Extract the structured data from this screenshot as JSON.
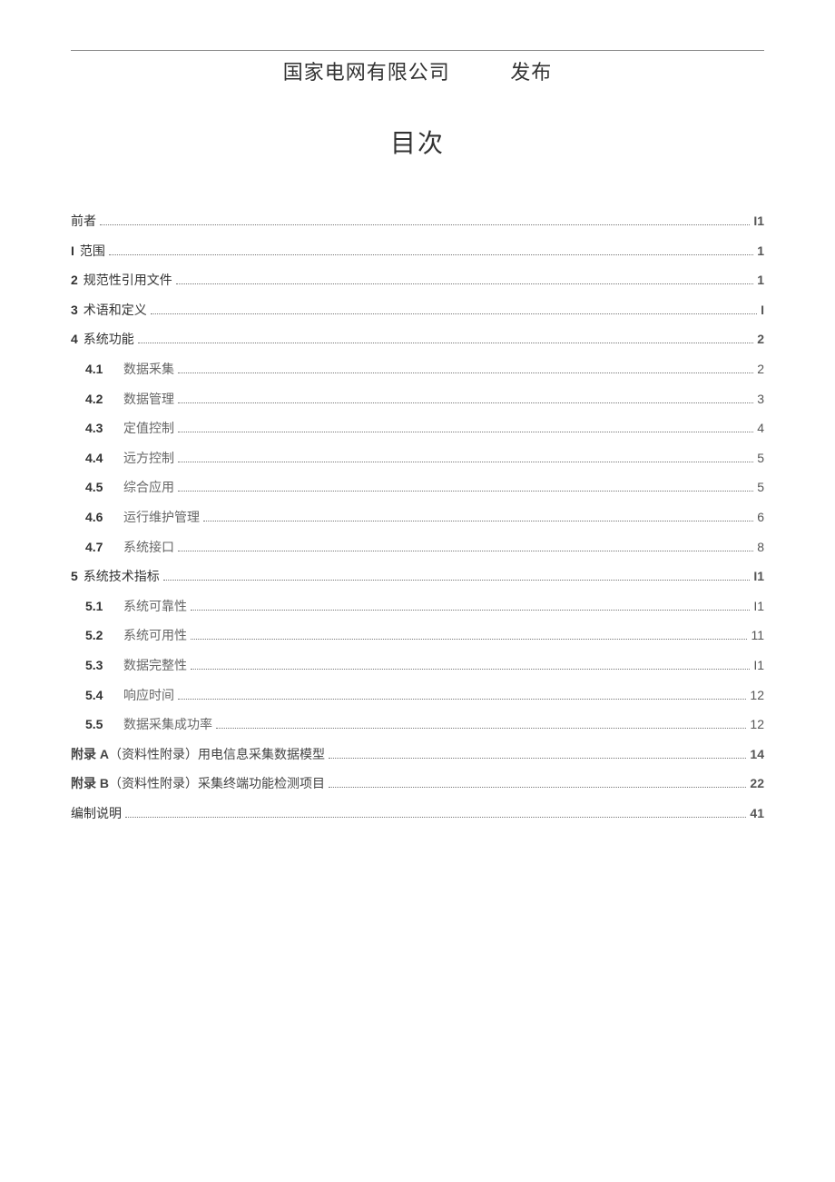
{
  "header": {
    "company": "国家电网有限公司",
    "publish": "发布"
  },
  "title": "目次",
  "toc": [
    {
      "type": "top",
      "num": "",
      "label": "前者",
      "page": "I1"
    },
    {
      "type": "top",
      "num": "I",
      "label": "范围",
      "page": "1"
    },
    {
      "type": "top",
      "num": "2",
      "label": "规范性引用文件",
      "page": "1"
    },
    {
      "type": "top",
      "num": "3",
      "label": "术语和定义",
      "page": "I"
    },
    {
      "type": "top",
      "num": "4",
      "label": "系统功能",
      "page": "2"
    },
    {
      "type": "sub",
      "num": "4.1",
      "label": "数据釆集",
      "page": "2"
    },
    {
      "type": "sub",
      "num": "4.2",
      "label": "数据管理",
      "page": "3"
    },
    {
      "type": "sub",
      "num": "4.3",
      "label": "定值控制",
      "page": "4"
    },
    {
      "type": "sub",
      "num": "4.4",
      "label": "远方控制",
      "page": "5"
    },
    {
      "type": "sub",
      "num": "4.5",
      "label": "综合应用",
      "page": "5"
    },
    {
      "type": "sub",
      "num": "4.6",
      "label": "运行维护管理",
      "page": "6"
    },
    {
      "type": "sub",
      "num": "4.7",
      "label": "系统接口",
      "page": "8"
    },
    {
      "type": "top",
      "num": "5",
      "label": "系统技术指标",
      "page": "I1"
    },
    {
      "type": "sub",
      "num": "5.1",
      "label": "系统可靠性",
      "page": "I1"
    },
    {
      "type": "sub",
      "num": "5.2",
      "label": "系统可用性",
      "page": "11"
    },
    {
      "type": "sub",
      "num": "5.3",
      "label": "数据完整性",
      "page": "I1"
    },
    {
      "type": "sub",
      "num": "5.4",
      "label": "响应时间",
      "page": "12"
    },
    {
      "type": "sub",
      "num": "5.5",
      "label": "数据采集成功率",
      "page": "12"
    },
    {
      "type": "appendix",
      "prefix": "附录 A",
      "label": "（资料性附录）用电信息采集数据模型",
      "page": "14"
    },
    {
      "type": "appendix",
      "prefix": "附录 B",
      "label": "（资料性附录）采集终端功能检测项目",
      "page": "22"
    },
    {
      "type": "top",
      "num": "",
      "label": "编制说明",
      "page": "41"
    }
  ]
}
